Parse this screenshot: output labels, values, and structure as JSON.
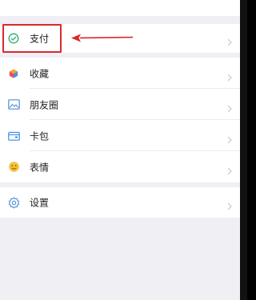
{
  "menu": {
    "payment_label": "支付",
    "favorites_label": "收藏",
    "moments_label": "朋友圈",
    "cards_label": "卡包",
    "stickers_label": "表情",
    "settings_label": "设置"
  },
  "icons": {
    "payment": "payment-check-icon",
    "favorites": "favorites-cube-icon",
    "moments": "moments-picture-icon",
    "cards": "card-wallet-icon",
    "stickers": "sticker-smile-icon",
    "settings": "settings-gear-icon",
    "chevron": "chevron-right-icon"
  },
  "colors": {
    "highlight": "#d92a2a",
    "payment_green": "#2aae67",
    "favorites_orange": "#f3a33b",
    "moments_blue": "#4f8fd8",
    "cards_blue": "#3a8ee6",
    "stickers_yellow": "#f5c23c",
    "settings_blue": "#4f8fd8"
  }
}
